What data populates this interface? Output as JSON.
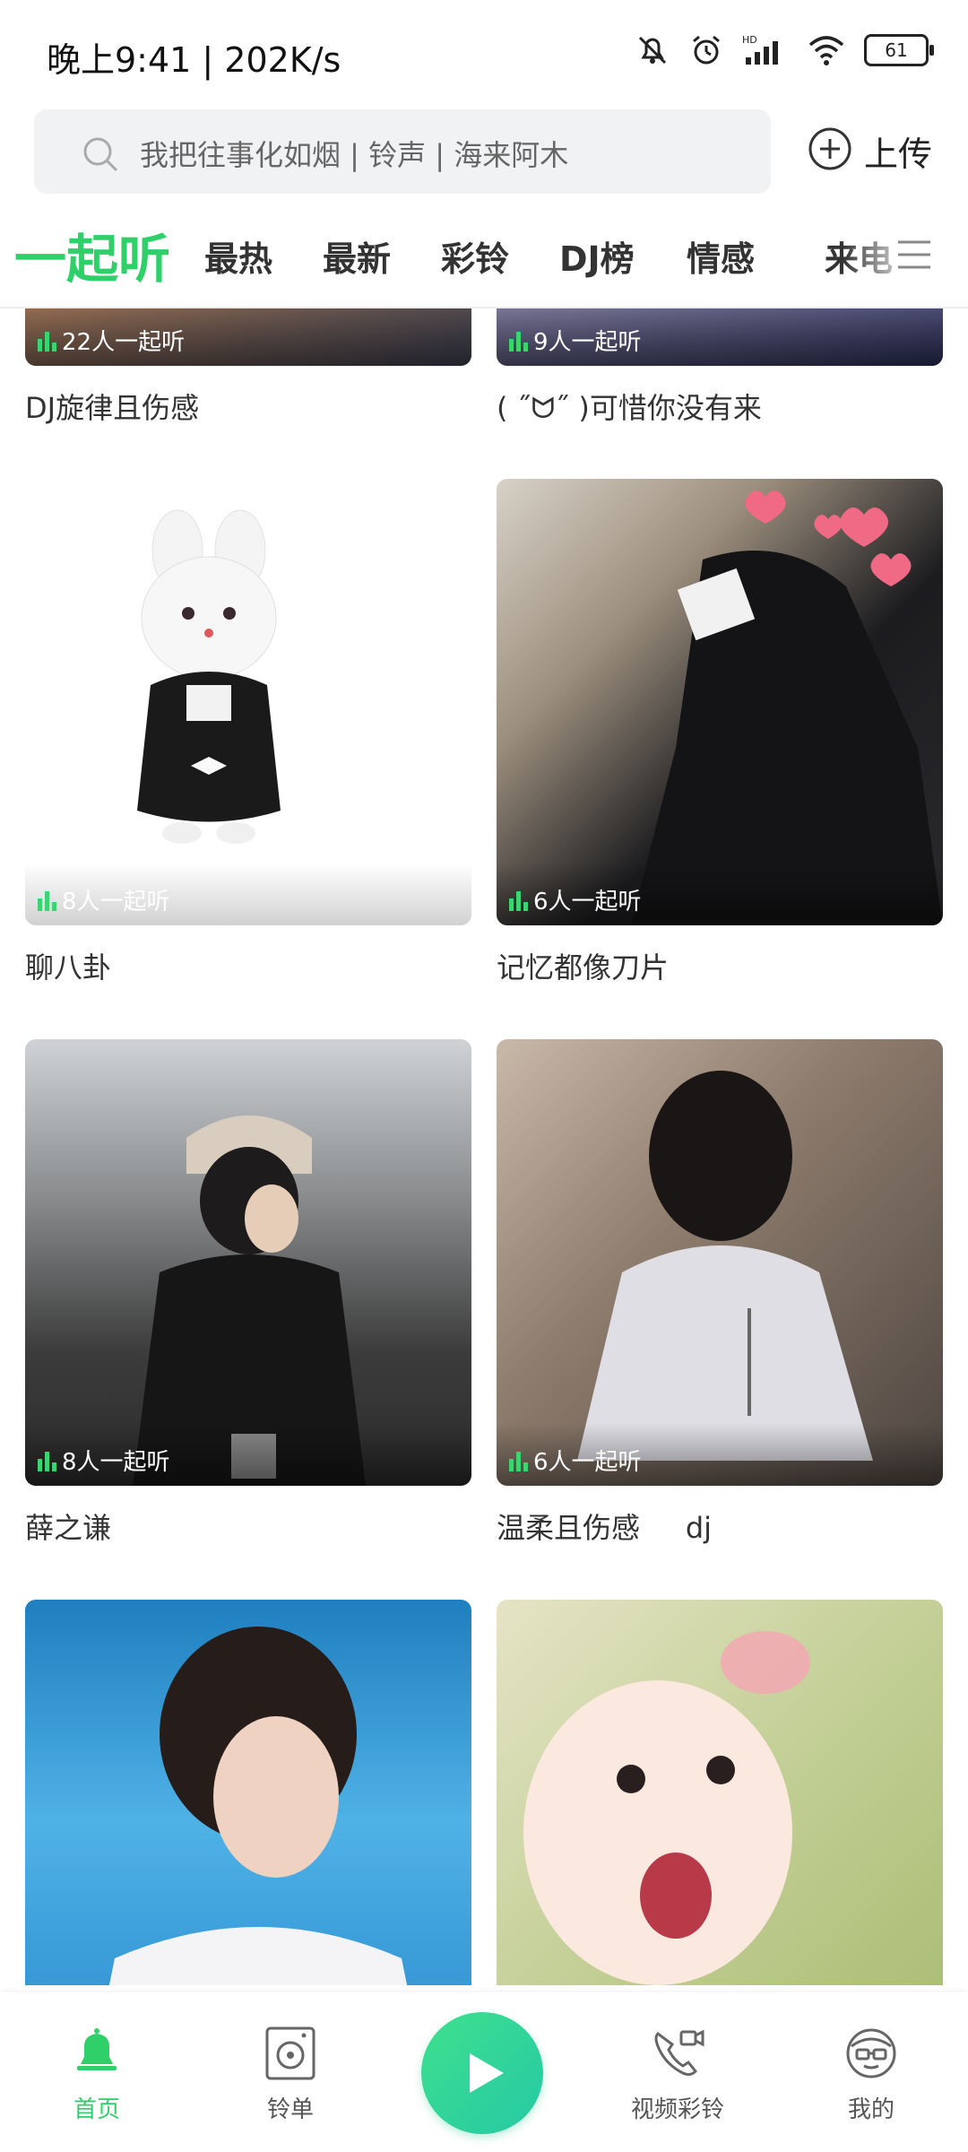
{
  "status_bar": {
    "time_speed": "晚上9:41 | 202K/s",
    "hd_label": "HD",
    "battery": "61"
  },
  "search": {
    "placeholder": "我把往事化如烟 | 铃声 | 海来阿木",
    "upload_label": "上传"
  },
  "tabs": [
    {
      "label": "一起听",
      "active": true
    },
    {
      "label": "最热"
    },
    {
      "label": "最新"
    },
    {
      "label": "彩铃"
    },
    {
      "label": "DJ榜"
    },
    {
      "label": "情感"
    },
    {
      "label": "来电"
    }
  ],
  "cards": [
    {
      "title": "DJ旋律且伤感",
      "listeners": "22人一起听"
    },
    {
      "title": "( ˝ᗢ˝ )可惜你没有来",
      "listeners": "9人一起听"
    },
    {
      "title": "聊八卦",
      "listeners": "8人一起听"
    },
    {
      "title": "记忆都像刀片",
      "listeners": "6人一起听"
    },
    {
      "title": "薛之谦",
      "listeners": "8人一起听"
    },
    {
      "title": "温柔且伤感     dj",
      "listeners": "6人一起听"
    },
    {
      "title": "",
      "listeners": ""
    },
    {
      "title": "",
      "listeners": ""
    }
  ],
  "bottom_nav": [
    {
      "label": "首页",
      "icon": "bell-icon",
      "active": true
    },
    {
      "label": "铃单",
      "icon": "speaker-icon"
    },
    {
      "label": "",
      "icon": "play-icon"
    },
    {
      "label": "视频彩铃",
      "icon": "video-phone-icon"
    },
    {
      "label": "我的",
      "icon": "profile-face-icon"
    }
  ],
  "colors": {
    "accent": "#2fcf6a",
    "search_bg": "#f1f2f4"
  }
}
